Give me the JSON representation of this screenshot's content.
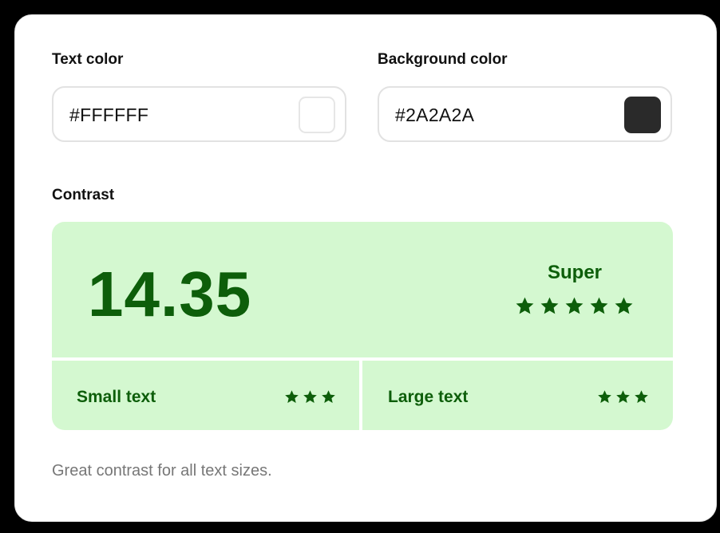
{
  "text_color": {
    "label": "Text color",
    "value": "#FFFFFF",
    "swatch_color": "#FFFFFF"
  },
  "background_color": {
    "label": "Background color",
    "value": "#2A2A2A",
    "swatch_color": "#2A2A2A"
  },
  "contrast": {
    "label": "Contrast",
    "ratio": "14.35",
    "rating": "Super",
    "rating_stars": 5,
    "small_text": {
      "label": "Small text",
      "stars": 3
    },
    "large_text": {
      "label": "Large text",
      "stars": 3
    },
    "panel_color": "#D4F8D0",
    "accent_color": "#0D5E0A"
  },
  "hint": "Great contrast for all text sizes.",
  "icons": {
    "star": "star-icon"
  }
}
